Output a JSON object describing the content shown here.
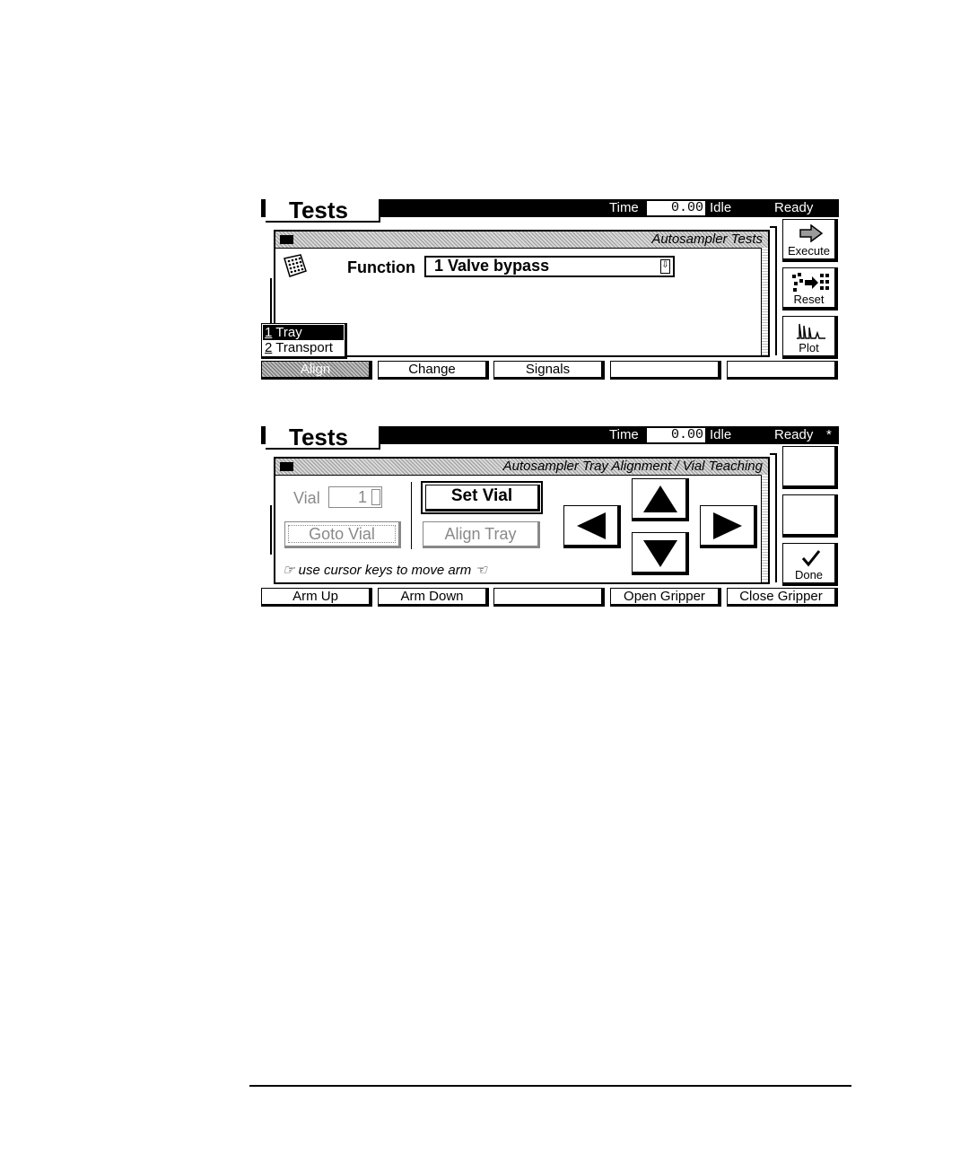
{
  "screens": [
    {
      "title": "Tests",
      "header": {
        "time_label": "Time",
        "time_value": "0.00",
        "state": "Idle",
        "status": "Ready",
        "flag": ""
      },
      "dialog_title": "Autosampler Tests",
      "function_label": "Function",
      "function_value": "1 Valve bypass",
      "popup_menu": [
        {
          "key": "1",
          "label": "Tray",
          "selected": true
        },
        {
          "key": "2",
          "label": "Transport",
          "selected": false
        }
      ],
      "side_buttons": [
        {
          "icon": "arrow-right-icon",
          "label": "Execute"
        },
        {
          "icon": "reset-icon",
          "label": "Reset"
        },
        {
          "icon": "plot-icon",
          "label": "Plot"
        }
      ],
      "softkeys": [
        "Align",
        "Change",
        "Signals",
        "",
        ""
      ],
      "active_softkey": "Align"
    },
    {
      "title": "Tests",
      "header": {
        "time_label": "Time",
        "time_value": "0.00",
        "state": "Idle",
        "status": "Ready",
        "flag": "*"
      },
      "dialog_title": "Autosampler Tray Alignment / Vial Teaching",
      "vial_label": "Vial",
      "vial_value": "1",
      "goto_vial": "Goto Vial",
      "set_vial": "Set Vial",
      "align_tray": "Align Tray",
      "hint": "use cursor keys to move arm",
      "side_buttons": [
        {
          "icon": "",
          "label": ""
        },
        {
          "icon": "",
          "label": ""
        },
        {
          "icon": "checkmark-icon",
          "label": "Done"
        }
      ],
      "softkeys": [
        "Arm Up",
        "Arm Down",
        "",
        "Open Gripper",
        "Close Gripper"
      ]
    }
  ]
}
